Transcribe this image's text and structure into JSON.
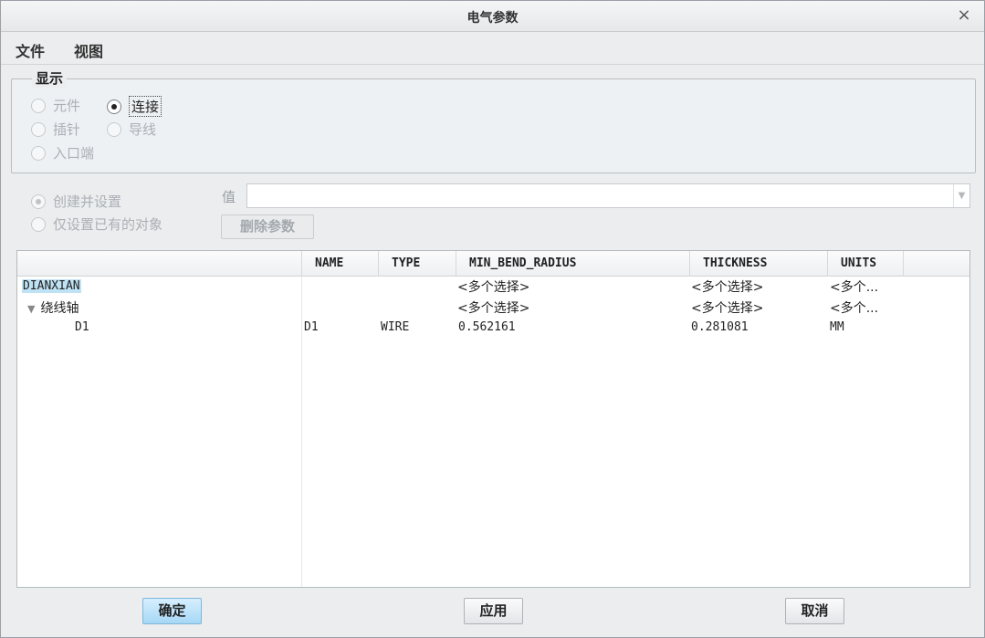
{
  "window": {
    "title": "电气参数",
    "close_glyph": "×"
  },
  "menu": [
    {
      "label": "文件"
    },
    {
      "label": "视图"
    }
  ],
  "display_group": {
    "legend": "显示",
    "options": [
      {
        "label": "元件",
        "selected": false
      },
      {
        "label": "连接",
        "selected": true
      },
      {
        "label": "插针",
        "selected": false
      },
      {
        "label": "导线",
        "selected": false
      },
      {
        "label": "入口端",
        "selected": false
      }
    ]
  },
  "mode": {
    "options": [
      {
        "label": "创建并设置",
        "selected": true
      },
      {
        "label": "仅设置已有的对象",
        "selected": false
      }
    ]
  },
  "value_field": {
    "label": "值",
    "value": ""
  },
  "delete_button": "删除参数",
  "table": {
    "columns": [
      "NAME",
      "TYPE",
      "MIN_BEND_RADIUS",
      "THICKNESS",
      "UNITS"
    ],
    "rows": [
      {
        "tree": "DIANXIAN",
        "name": "",
        "type": "",
        "min_bend_radius": "<多个选择>",
        "thickness": "<多个选择>",
        "units": "<多个..."
      },
      {
        "tree": "绕线轴",
        "name": "",
        "type": "",
        "min_bend_radius": "<多个选择>",
        "thickness": "<多个选择>",
        "units": "<多个..."
      },
      {
        "tree": "D1",
        "name": "D1",
        "type": "WIRE",
        "min_bend_radius": "0.562161",
        "thickness": "0.281081",
        "units": "MM"
      }
    ],
    "expand_glyph": "▼"
  },
  "buttons": {
    "ok": "确定",
    "apply": "应用",
    "cancel": "取消"
  }
}
